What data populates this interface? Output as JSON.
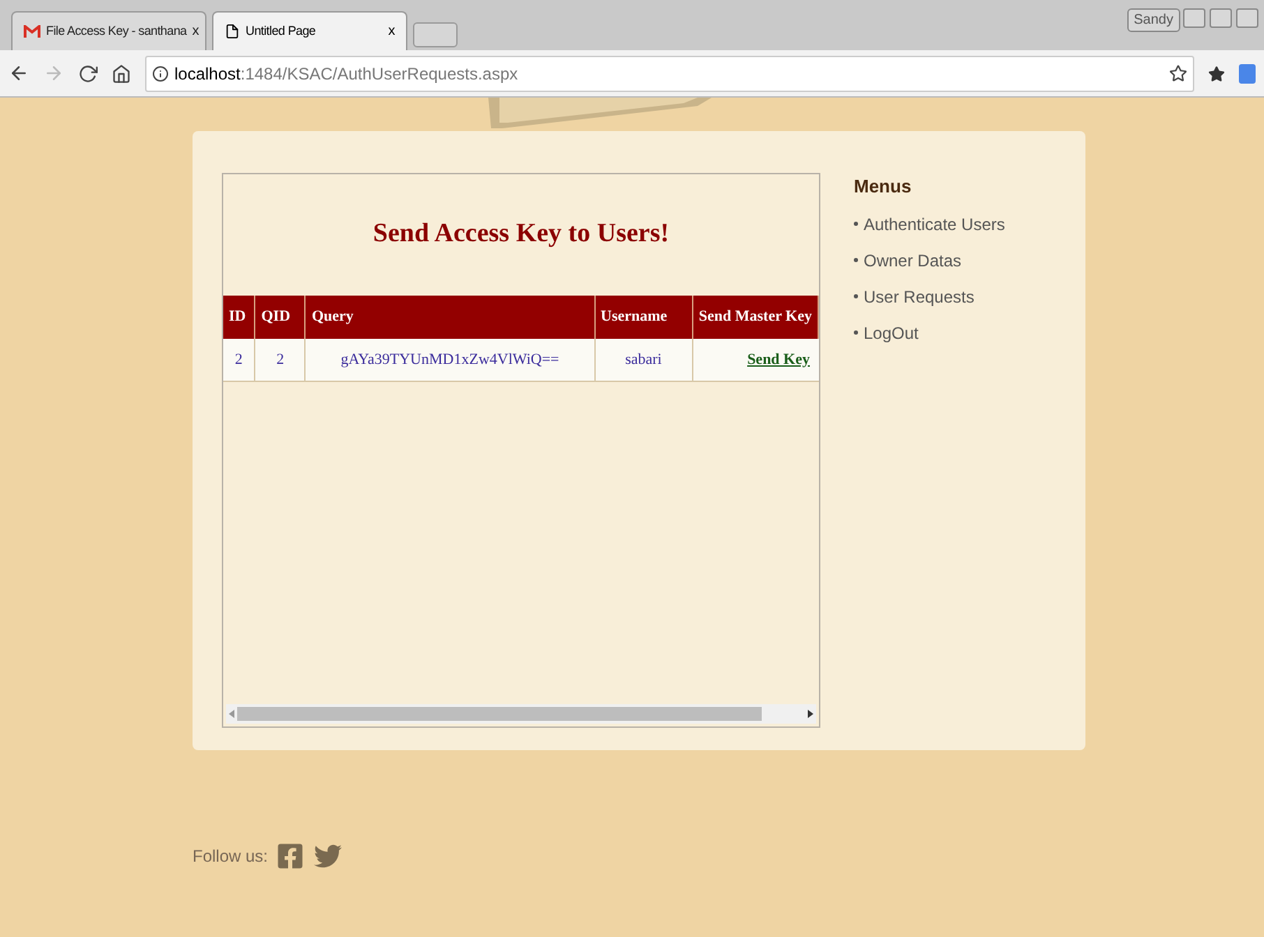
{
  "browser": {
    "tabs": [
      {
        "title": "File Access Key - santhana",
        "selected": false,
        "kind": "mail",
        "close": "x"
      },
      {
        "title": "Untitled Page",
        "selected": true,
        "kind": "page",
        "close": "x"
      }
    ],
    "user": "Sandy",
    "address": {
      "host": "localhost",
      "path": ":1484/KSAC/AuthUserRequests.aspx"
    }
  },
  "page": {
    "title": "Send Access Key to Users!",
    "table": {
      "columns": [
        "ID",
        "QID",
        "Query",
        "Username",
        "Send Master Key"
      ],
      "rows": [
        {
          "id": "2",
          "qid": "2",
          "query": "gAYa39TYUnMD1xZw4VlWiQ==",
          "username": "sabari",
          "action": "Send Key"
        }
      ]
    },
    "menu": {
      "title": "Menus",
      "items": [
        "Authenticate Users",
        "Owner Datas",
        "User Requests",
        "LogOut"
      ]
    },
    "footer": {
      "follow": "Follow us:"
    }
  }
}
